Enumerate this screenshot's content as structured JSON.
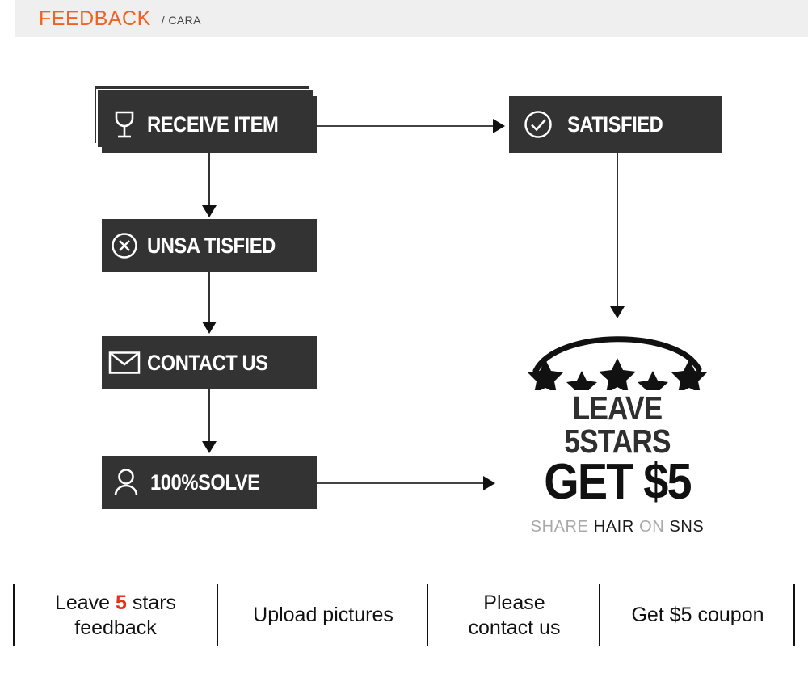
{
  "header": {
    "title": "FEEDBACK",
    "subtitle": "/ CARA",
    "accent_color": "#ef6321",
    "band_color": "#efefef"
  },
  "flow": {
    "boxes": [
      {
        "id": "receive",
        "label": "RECEIVE ITEM",
        "icon": "wine-glass-icon",
        "stacked": true
      },
      {
        "id": "unsat",
        "label": "UNSA TISFIED",
        "icon": "circle-x-icon",
        "stacked": false
      },
      {
        "id": "contact",
        "label": "CONTACT US",
        "icon": "envelope-icon",
        "stacked": false
      },
      {
        "id": "solve",
        "label": "100%SOLVE",
        "icon": "person-icon",
        "stacked": false
      },
      {
        "id": "satisfied",
        "label": "SATISFIED",
        "icon": "circle-check-icon",
        "stacked": false
      }
    ],
    "box_color": "#333333",
    "arrow_color": "#111111"
  },
  "badge": {
    "stars_icon": "five-stars-arc-icon",
    "star_count": 5,
    "line1": "LEAVE 5STARS",
    "line2": "GET $5",
    "line3": {
      "word1": "SHARE",
      "word2": "HAIR",
      "word3": "ON",
      "word4": "SNS"
    }
  },
  "footer": {
    "cells": [
      {
        "line1_pre": "Leave ",
        "highlight": "5",
        "line1_post": " stars",
        "line2": "feedback"
      },
      {
        "line1_pre": "Upload pictures",
        "highlight": "",
        "line1_post": "",
        "line2": ""
      },
      {
        "line1_pre": "Please",
        "highlight": "",
        "line1_post": "",
        "line2": "contact us"
      },
      {
        "line1_pre": "Get $5 coupon",
        "highlight": "",
        "line1_post": "",
        "line2": ""
      }
    ],
    "highlight_color": "#e03518"
  }
}
